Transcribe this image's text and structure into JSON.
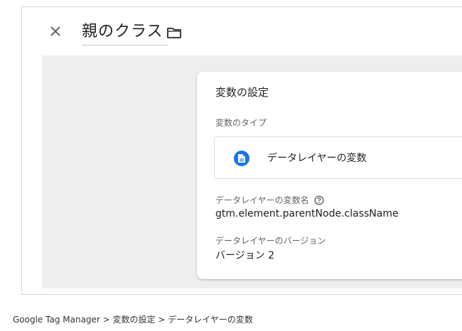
{
  "header": {
    "title": "親のクラス",
    "close_icon": "close-icon",
    "folder_icon": "folder-icon"
  },
  "card": {
    "title": "変数の設定",
    "type_label": "変数のタイプ",
    "type_name": "データレイヤーの変数",
    "type_icon": "document-icon",
    "var_name_label": "データレイヤーの変数名",
    "var_name_value": "gtm.element.parentNode.className",
    "help_icon": "help-icon",
    "version_label": "データレイヤーのバージョン",
    "version_value": "バージョン 2"
  },
  "caption": "Google Tag Manager > 変数の設定 > データレイヤーの変数",
  "colors": {
    "accent": "#1a73e8",
    "canvas": "#eeeeee",
    "text": "#202124",
    "secondary_text": "#5f6368"
  }
}
